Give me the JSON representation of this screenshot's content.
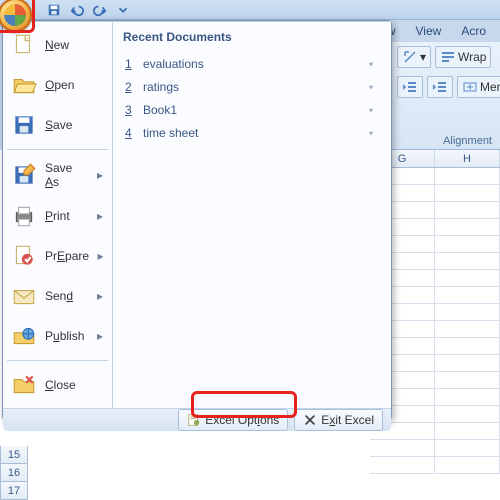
{
  "qat": [
    "save",
    "undo",
    "redo",
    "dropdown"
  ],
  "ribbon": {
    "tabs": [
      "w",
      "View",
      "Acro"
    ],
    "group": "Alignment",
    "wrap": "Wrap",
    "merge": "Merg"
  },
  "columns": [
    "G",
    "H"
  ],
  "rows": [
    "15",
    "16",
    "17"
  ],
  "menu": {
    "items": [
      {
        "key": "new",
        "ic": "new",
        "label": "New",
        "u": "N",
        "rest": "ew"
      },
      {
        "key": "open",
        "ic": "open",
        "label": "Open",
        "u": "O",
        "rest": "pen"
      },
      {
        "key": "save",
        "ic": "save",
        "label": "Save",
        "u": "S",
        "rest": "ave"
      },
      {
        "key": "saveas",
        "ic": "saveas",
        "label": "Save As",
        "u": "A",
        "pre": "Save ",
        "rest": "s",
        "arrow": true
      },
      {
        "key": "print",
        "ic": "print",
        "label": "Print",
        "u": "P",
        "rest": "rint",
        "arrow": true
      },
      {
        "key": "prepare",
        "ic": "prepare",
        "label": "Prepare",
        "u": "E",
        "pre": "Pr",
        "rest": "pare",
        "arrow": true
      },
      {
        "key": "send",
        "ic": "send",
        "label": "Send",
        "u": "d",
        "pre": "Sen",
        "rest": "",
        "arrow": true
      },
      {
        "key": "publish",
        "ic": "publish",
        "label": "Publish",
        "u": "u",
        "pre": "P",
        "rest": "blish",
        "arrow": true
      },
      {
        "key": "close",
        "ic": "close",
        "label": "Close",
        "u": "C",
        "rest": "lose"
      }
    ],
    "recentTitle": "Recent Documents",
    "recent": [
      {
        "n": "1",
        "name": "evaluations"
      },
      {
        "n": "2",
        "name": "ratings"
      },
      {
        "n": "3",
        "name": "Book1"
      },
      {
        "n": "4",
        "name": "time sheet"
      }
    ],
    "options": "Excel Options",
    "optionsU": "I",
    "exit": "Exit Excel",
    "exitU": "x"
  }
}
